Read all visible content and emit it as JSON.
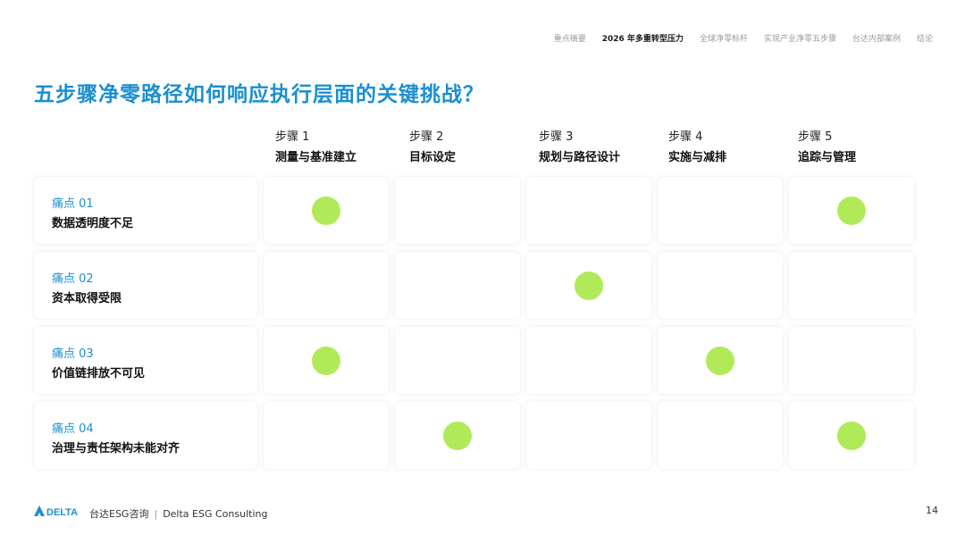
{
  "nav": {
    "items": [
      "重点摘要",
      "2026 年多重转型压力",
      "全球净零标杆",
      "实现产业净零五步骤",
      "台达内部案例",
      "结论"
    ],
    "active_index": 1
  },
  "title": "五步骤净零路径如何响应执行层面的关键挑战？",
  "steps": [
    {
      "no": "步骤 1",
      "name": "测量与基准建立"
    },
    {
      "no": "步骤 2",
      "name": "目标设定"
    },
    {
      "no": "步骤 3",
      "name": "规划与路径设计"
    },
    {
      "no": "步骤 4",
      "name": "实施与减排"
    },
    {
      "no": "步骤 5",
      "name": "追踪与管理"
    }
  ],
  "pains": [
    {
      "id": "痛点 01",
      "name": "数据透明度不足",
      "marks": [
        true,
        false,
        false,
        false,
        true
      ]
    },
    {
      "id": "痛点 02",
      "name": "资本取得受限",
      "marks": [
        false,
        false,
        true,
        false,
        false
      ]
    },
    {
      "id": "痛点 03",
      "name": "价值链排放不可见",
      "marks": [
        true,
        false,
        false,
        true,
        false
      ]
    },
    {
      "id": "痛点 04",
      "name": "治理与责任架构未能对齐",
      "marks": [
        false,
        true,
        false,
        false,
        true
      ]
    }
  ],
  "colors": {
    "accent": "#1a8fd0",
    "dot": "#b0ea58"
  },
  "footer": {
    "logo_text": "DELTA",
    "cn": "台达ESG咨询",
    "sep": "|",
    "en": "Delta ESG Consulting",
    "page": "14"
  }
}
